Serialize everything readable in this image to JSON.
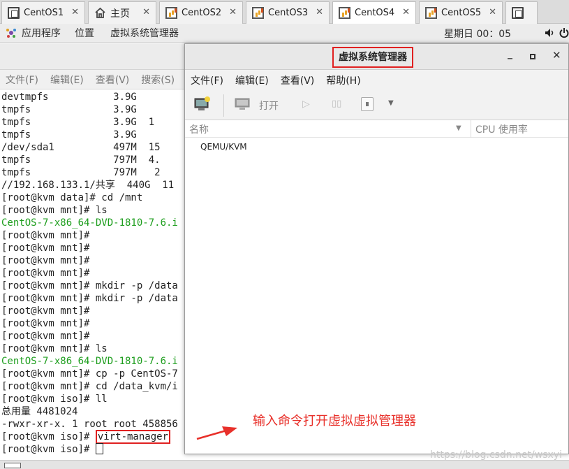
{
  "tabs": [
    {
      "label": "CentOS1",
      "icon": "window-icon"
    },
    {
      "label": "主页",
      "icon": "home-icon"
    },
    {
      "label": "CentOS2",
      "icon": "vm-icon"
    },
    {
      "label": "CentOS3",
      "icon": "vm-icon"
    },
    {
      "label": "CentOS4",
      "icon": "vm-icon"
    },
    {
      "label": "CentOS5",
      "icon": "vm-icon"
    }
  ],
  "tab_close_glyph": "✕",
  "panel": {
    "apps": "应用程序",
    "places": "位置",
    "virt_manager": "虚拟系统管理器",
    "clock": "星期日 00：05"
  },
  "terminal": {
    "menu": [
      "文件(F)",
      "编辑(E)",
      "查看(V)",
      "搜索(S)"
    ],
    "lines": [
      {
        "text": "devtmpfs           3.9G",
        "color": "default"
      },
      {
        "text": "tmpfs              3.9G",
        "color": "default"
      },
      {
        "text": "tmpfs              3.9G  1",
        "color": "default"
      },
      {
        "text": "tmpfs              3.9G",
        "color": "default"
      },
      {
        "text": "/dev/sda1          497M  15",
        "color": "default"
      },
      {
        "text": "tmpfs              797M  4.",
        "color": "default"
      },
      {
        "text": "tmpfs              797M   2",
        "color": "default"
      },
      {
        "text": "//192.168.133.1/共享  440G  11",
        "color": "default"
      },
      {
        "text": "[root@kvm data]# cd /mnt",
        "color": "default"
      },
      {
        "text": "[root@kvm mnt]# ls",
        "color": "default"
      },
      {
        "text": "CentOS-7-x86_64-DVD-1810-7.6.i",
        "color": "green"
      },
      {
        "text": "[root@kvm mnt]#",
        "color": "default"
      },
      {
        "text": "[root@kvm mnt]#",
        "color": "default"
      },
      {
        "text": "[root@kvm mnt]#",
        "color": "default"
      },
      {
        "text": "[root@kvm mnt]#",
        "color": "default"
      },
      {
        "text": "[root@kvm mnt]# mkdir -p /data",
        "color": "default"
      },
      {
        "text": "[root@kvm mnt]# mkdir -p /data",
        "color": "default"
      },
      {
        "text": "[root@kvm mnt]#",
        "color": "default"
      },
      {
        "text": "[root@kvm mnt]#",
        "color": "default"
      },
      {
        "text": "[root@kvm mnt]#",
        "color": "default"
      },
      {
        "text": "[root@kvm mnt]# ls",
        "color": "default"
      },
      {
        "text": "CentOS-7-x86_64-DVD-1810-7.6.i",
        "color": "green"
      },
      {
        "text": "[root@kvm mnt]# cp -p CentOS-7",
        "color": "default"
      },
      {
        "text": "[root@kvm mnt]# cd /data_kvm/i",
        "color": "default"
      },
      {
        "text": "[root@kvm iso]# ll",
        "color": "default"
      },
      {
        "text": "总用量 4481024",
        "color": "default"
      },
      {
        "text": "-rwxr-xr-x. 1 root root 458856",
        "color": "default"
      }
    ],
    "prompt_cmd": "[root@kvm iso]# ",
    "highlighted_cmd": "virt-manager",
    "prompt_last": "[root@kvm iso]# "
  },
  "virt_manager": {
    "title": "虚拟系统管理器",
    "menu": [
      "文件(F)",
      "编辑(E)",
      "查看(V)",
      "帮助(H)"
    ],
    "toolbar_open": "打开",
    "col_name": "名称",
    "col_cpu": "CPU 使用率",
    "connection": "QEMU/KVM"
  },
  "annotation": "输入命令打开虚拟虚拟管理器",
  "watermark": "https://blog.csdn.net/wsxyi",
  "colors": {
    "accent_red": "#e02020",
    "terminal_green": "#1e9e1e"
  }
}
